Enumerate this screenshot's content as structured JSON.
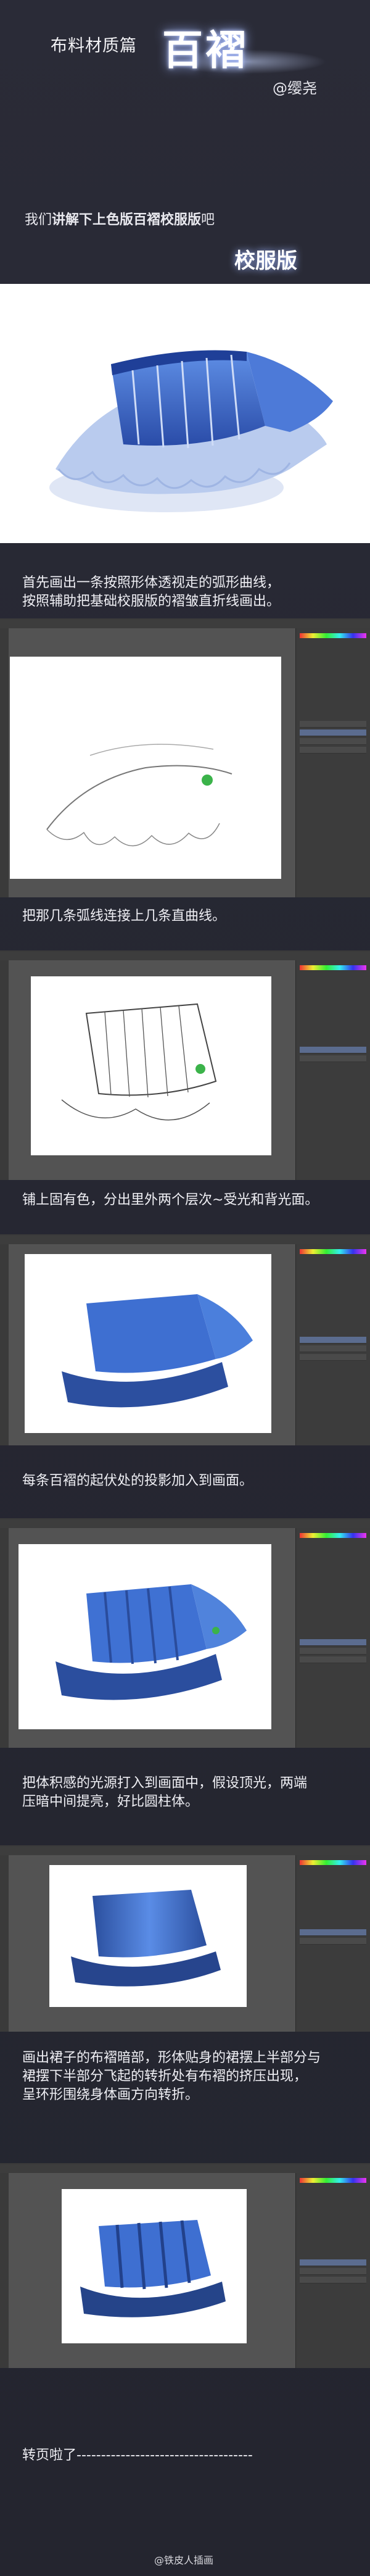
{
  "header": {
    "subtitle": "布料材质篇",
    "title": "百褶",
    "author": "@缨尧",
    "intro_prefix": "我们",
    "intro_bold": "讲解下上色版百褶校服版",
    "intro_suffix": "吧",
    "tag": "校服版"
  },
  "steps": [
    {
      "caption": "首先画出一条按照形体透视走的弧形曲线，\n按照辅助把基础校服版的褶皱直折线画出。"
    },
    {
      "caption": "把那几条弧线连接上几条直曲线。"
    },
    {
      "caption": "铺上固有色，分出里外两个层次~受光和背光面。"
    },
    {
      "caption": "每条百褶的起伏处的投影加入到画面。"
    },
    {
      "caption": "把体积感的光源打入到画面中，假设顶光，两端\n压暗中间提亮，好比圆柱体。"
    },
    {
      "caption": "画出裙子的布褶暗部，形体贴身的裙摆上半部分与\n裙摆下半部分飞起的转折处有布褶的挤压出现，\n呈环形围绕身体画方向转折。"
    }
  ],
  "footer": {
    "text": "转页啦了------------------------------------"
  },
  "watermark": "@铁皮人插画",
  "colors": {
    "skirt_blue": "#3a63c8",
    "skirt_dark": "#2a4590",
    "skirt_light": "#8fb3f0",
    "bg": "#2a2b37"
  }
}
